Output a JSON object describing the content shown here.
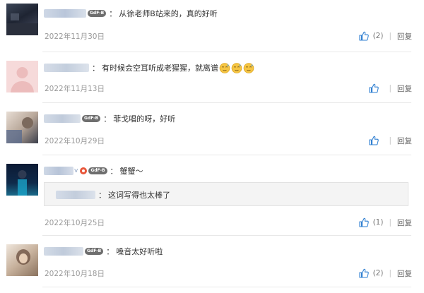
{
  "comments": [
    {
      "text": "从徐老师B站来的，真的好听",
      "date": "2022年11月30日",
      "likes": "(2)",
      "reply": "回复",
      "vip": "GdF-B"
    },
    {
      "text": "有时候会空耳听成老猩猩，就离谱",
      "date": "2022年11月13日",
      "likes": "",
      "reply": "回复",
      "emoji": [
        "sweat-smile",
        "sweat-smile",
        "sweat-smile"
      ]
    },
    {
      "text": "菲戈唱的呀，好听",
      "date": "2022年10月29日",
      "likes": "",
      "reply": "回复",
      "vip": "GdF-B"
    },
    {
      "text": "蟹蟹～",
      "date": "2022年10月25日",
      "likes": "(1)",
      "reply": "回复",
      "vip": "GdF-B",
      "sub_reply": {
        "text": "这词写得也太棒了"
      }
    },
    {
      "text": "嗓音太好听啦",
      "date": "2022年10月18日",
      "likes": "(2)",
      "reply": "回复",
      "vip": "GdF-B"
    }
  ],
  "separator": "：",
  "colors": {
    "thumb": "#2f7fd1",
    "like_text": "#777777",
    "date": "#999999"
  }
}
